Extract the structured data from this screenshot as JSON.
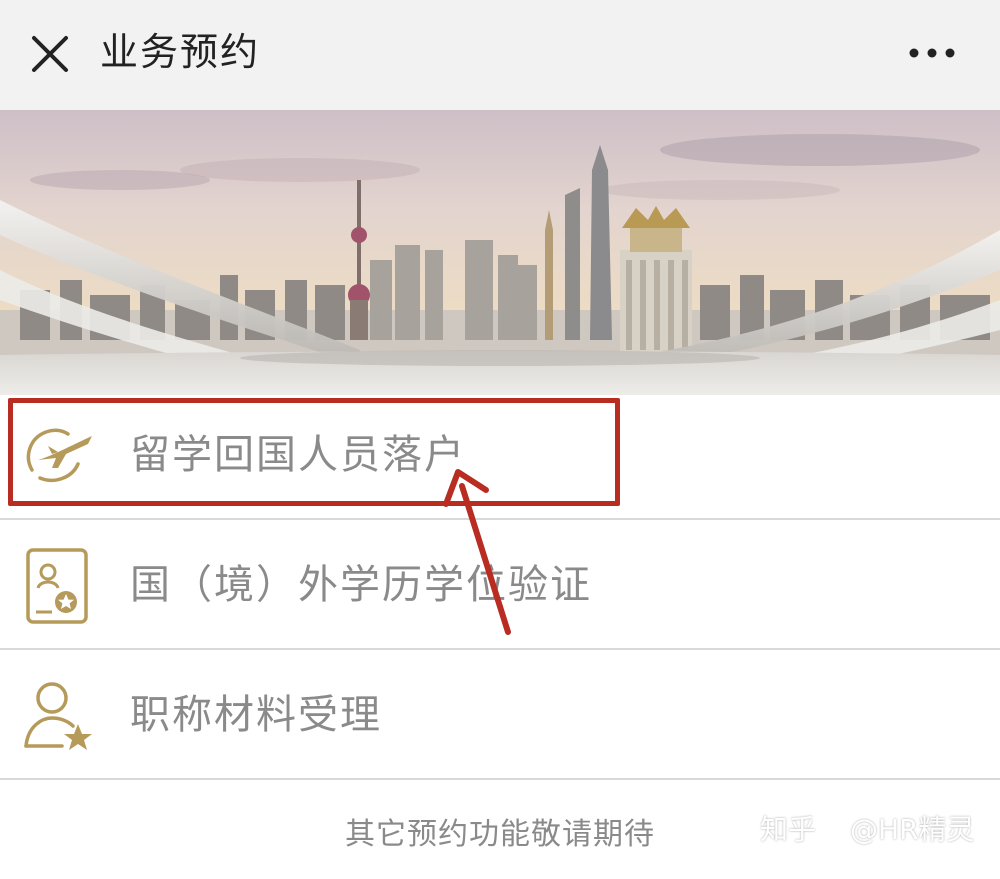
{
  "topbar": {
    "title": "业务预约",
    "close_icon": "close-icon",
    "more_icon": "more-horizontal-icon"
  },
  "banner": {
    "image": "shanghai-skyline-banner"
  },
  "menu": {
    "items": [
      {
        "label": "留学回国人员落户",
        "icon": "airplane-globe-icon"
      },
      {
        "label": "国（境）外学历学位验证",
        "icon": "certificate-icon"
      },
      {
        "label": "职称材料受理",
        "icon": "user-star-icon"
      }
    ]
  },
  "footer": {
    "note": "其它预约功能敬请期待"
  },
  "annotation": {
    "highlight_color": "#b82c22"
  },
  "watermark": {
    "site": "知乎",
    "author": "@HR精灵"
  },
  "colors": {
    "icon_gold": "#b59a5a",
    "label_gray": "#8a8a8a",
    "topbar_bg": "#f2f2f2"
  }
}
